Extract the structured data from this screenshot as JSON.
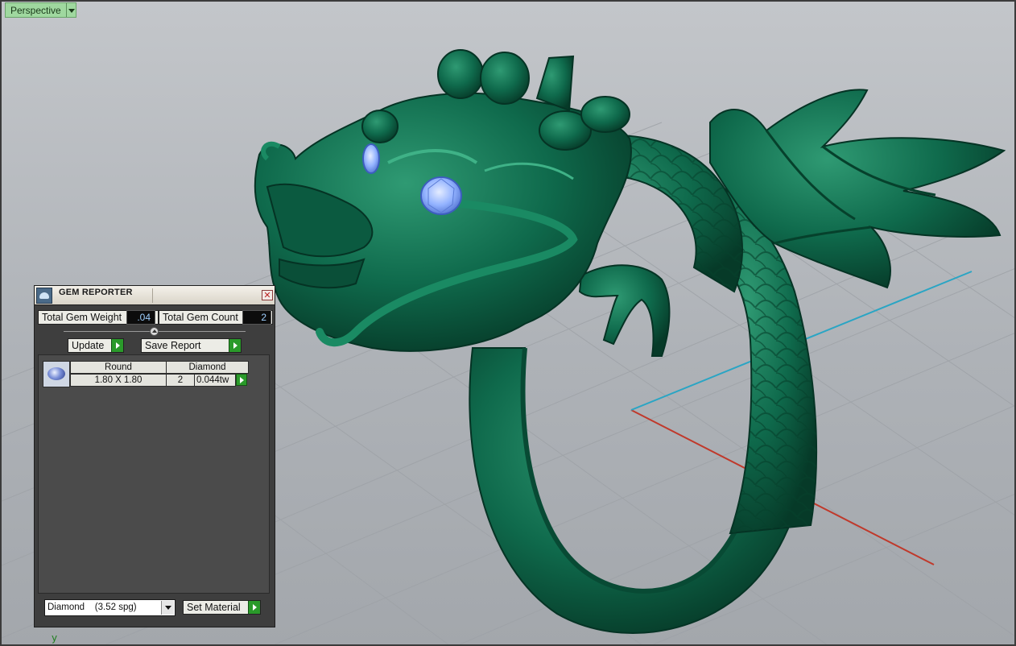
{
  "viewport": {
    "name": "Perspective",
    "axis_label": "y",
    "colors": {
      "ring": "#10674b",
      "gem": "#8fb2ff",
      "x_axis": "#c0392b",
      "y_axis": "#2aa5c4"
    }
  },
  "gem_reporter": {
    "title": "GEM REPORTER",
    "close_icon": "close-icon",
    "total_weight_label": "Total Gem Weight",
    "total_weight_value": ".04",
    "total_count_label": "Total Gem Count",
    "total_count_value": "2",
    "update_label": "Update",
    "save_report_label": "Save Report",
    "gem_list": {
      "header_shape": "Round",
      "header_material": "Diamond",
      "size": "1.80 X 1.80",
      "count": "2",
      "weight": "0.044tw"
    },
    "material_select": "Diamond    (3.52 spg)",
    "set_material_label": "Set Material"
  }
}
